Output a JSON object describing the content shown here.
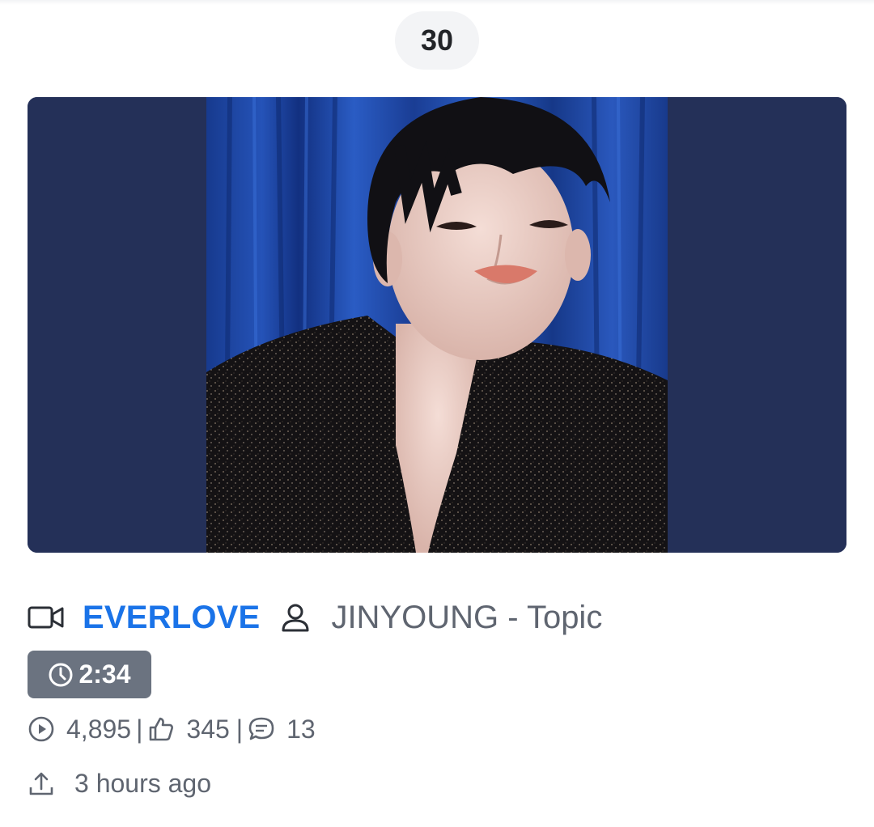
{
  "rank": "30",
  "video": {
    "title": "EVERLOVE",
    "channel": "JINYOUNG - Topic",
    "duration": "2:34",
    "views": "4,895",
    "likes": "345",
    "comments": "13",
    "uploaded": "3 hours ago",
    "separator": "|"
  },
  "icons": {
    "video": "video-camera-icon",
    "person": "person-icon",
    "clock": "clock-icon",
    "play": "play-circle-icon",
    "like": "thumbs-up-icon",
    "comment": "comment-bubble-icon",
    "upload": "upload-icon"
  },
  "colors": {
    "title_accent": "#1a73e8",
    "thumbnail_background": "#243058",
    "duration_badge": "#6b7380",
    "text_muted": "#5f6570"
  }
}
